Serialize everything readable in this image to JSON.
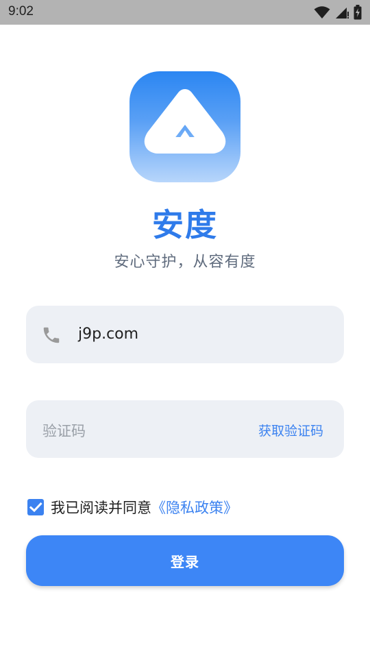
{
  "status_bar": {
    "time": "9:02",
    "icons": [
      "wifi-icon",
      "signal-icon",
      "battery-charging-icon"
    ],
    "background": "#b3b3b3"
  },
  "app": {
    "logo_icon": "triangle-logo-icon",
    "name": "安度",
    "slogan": "安心守护，从容有度",
    "brand_color": "#2f7bea"
  },
  "form": {
    "phone": {
      "icon": "phone-icon",
      "value": "j9p.com"
    },
    "code": {
      "placeholder": "验证码",
      "get_code_label": "获取验证码"
    },
    "agreement": {
      "checked": true,
      "text": "我已阅读并同意",
      "policy_link": "《隐私政策》"
    },
    "login_label": "登录",
    "accent_color": "#3d86f6"
  }
}
